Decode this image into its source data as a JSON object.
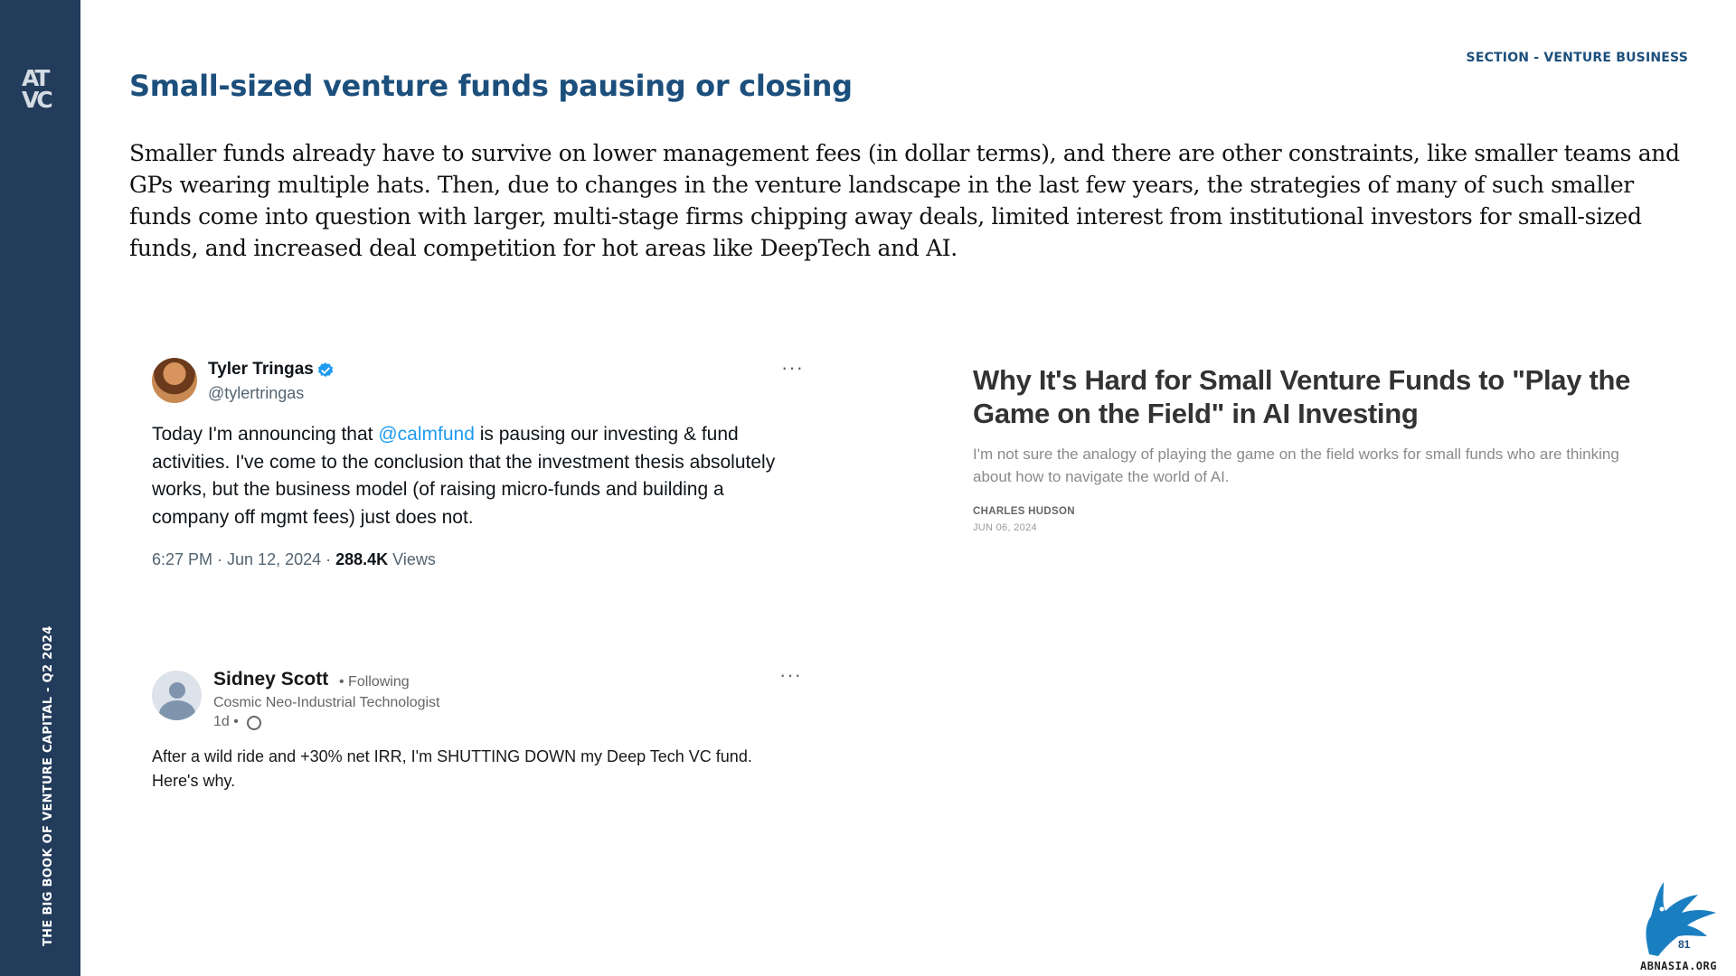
{
  "sidebar": {
    "logo_top": "AT",
    "logo_bottom": "VC",
    "vertical_text": "THE BIG BOOK OF VENTURE CAPITAL - Q2 2024"
  },
  "header": {
    "section_label": "SECTION - VENTURE BUSINESS",
    "title": "Small-sized venture funds pausing or closing"
  },
  "body": {
    "paragraph": "Smaller funds already have to survive on lower management fees (in dollar terms), and there are other constraints, like smaller teams and GPs wearing multiple hats. Then, due to changes in the venture landscape in the last few years, the strategies of many of such smaller funds come into question with larger, multi-stage firms chipping away deals, limited interest from institutional investors for small-sized funds, and increased deal competition for hot areas like DeepTech and AI."
  },
  "tweet": {
    "name": "Tyler Tringas",
    "handle": "@tylertringas",
    "more": "···",
    "text_before": "Today I'm announcing that ",
    "mention": "@calmfund",
    "text_after": " is pausing our investing & fund activities. I've come to the conclusion that the investment thesis absolutely works, but the business model (of raising micro-funds and building a company off mgmt fees) just does not.",
    "timestamp": "6:27 PM · Jun 12, 2024 · ",
    "views_count": "288.4K",
    "views_label": " Views",
    "colors": {
      "mention": "#1d9bf0",
      "verified": "#1d9bf0"
    },
    "icons": [
      "verified-badge-icon",
      "more-options-icon"
    ]
  },
  "linkedin_post": {
    "name": "Sidney Scott",
    "following": "• Following",
    "headline": "Cosmic Neo-Industrial Technologist",
    "time": "1d •",
    "more": "···",
    "text": "After a wild ride and +30% net IRR, I'm SHUTTING DOWN my Deep Tech VC fund. Here's why.",
    "icons": [
      "avatar-placeholder-icon",
      "globe-icon",
      "more-options-icon"
    ]
  },
  "article": {
    "title": "Why It's Hard for Small Venture Funds to \"Play the Game on the Field\" in AI Investing",
    "subtitle": "I'm not sure the analogy of playing the game on the field works for small funds who are thinking about how to navigate the world of AI.",
    "author": "CHARLES HUDSON",
    "date": "JUN 06, 2024"
  },
  "footer": {
    "page_number": "81",
    "watermark_text": "ABNASIA.ORG"
  },
  "colors": {
    "sidebar": "#233c5c",
    "heading": "#1c4f7c",
    "watermark_bird": "#1a7fc1"
  }
}
